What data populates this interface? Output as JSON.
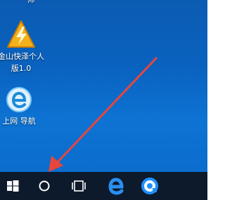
{
  "desktop": {
    "top_label": "师",
    "icons": [
      {
        "label_line1": "金山快泽个人",
        "label_line2": "版1.0",
        "icon": "lightning-icon"
      },
      {
        "label": "上网 导航",
        "icon": "ie-browser-icon"
      }
    ]
  },
  "taskbar": {
    "buttons": [
      {
        "name": "start",
        "icon": "windows-logo-icon"
      },
      {
        "name": "search",
        "icon": "search-circle-icon"
      },
      {
        "name": "task-view",
        "icon": "task-view-icon"
      },
      {
        "name": "edge",
        "icon": "edge-icon"
      },
      {
        "name": "app",
        "icon": "app-circle-icon"
      }
    ]
  },
  "annotation": {
    "type": "arrow",
    "color": "#e8453c",
    "points_to": "search"
  },
  "colors": {
    "desktop_blue": "#0a63c0",
    "taskbar": "#0d1a2c",
    "accent_blue": "#1e90ff",
    "arrow_red": "#e8453c"
  }
}
